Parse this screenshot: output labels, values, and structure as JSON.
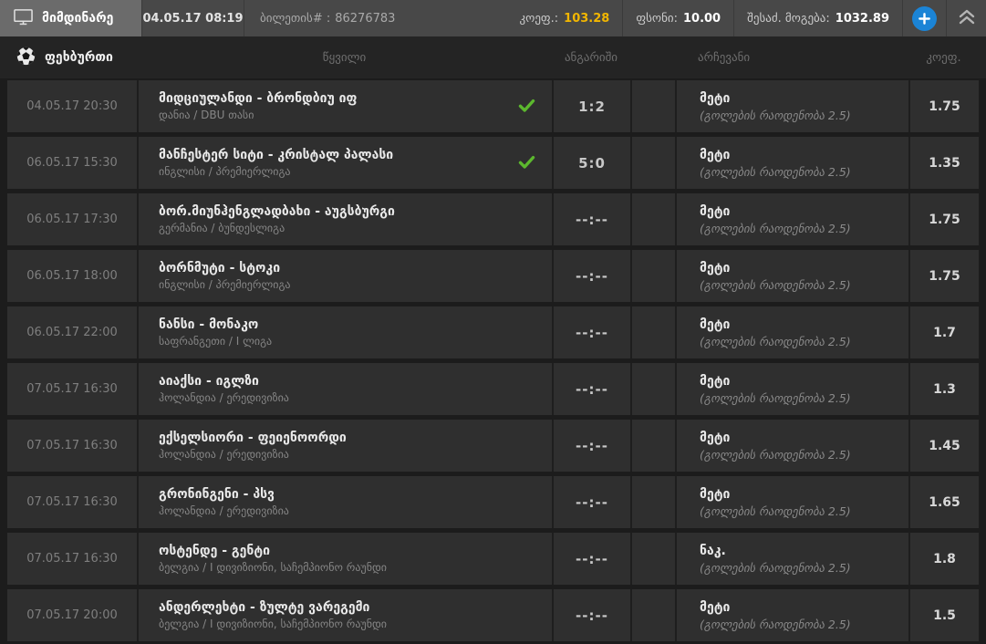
{
  "topbar": {
    "tab_label": "მიმდინარე",
    "datetime": "04.05.17 08:19",
    "ticket_label": "ბილეთის# :",
    "ticket_number": "86276783",
    "coef_label": "კოეფ.:",
    "coef_value": "103.28",
    "stake_label": "ფსონი:",
    "stake_value": "10.00",
    "win_label": "შესაძ. მოგება:",
    "win_value": "1032.89"
  },
  "section": {
    "sport_label": "ფეხბურთი",
    "columns": {
      "pair": "წყვილი",
      "score": "ანგარიში",
      "selection": "არჩევანი",
      "coef": "კოეფ."
    }
  },
  "rows": [
    {
      "datetime": "04.05.17 20:30",
      "pair": "მიდციულანდი - ბრონდბიუ იფ",
      "league": "დანია / DBU თასი",
      "won": true,
      "score": "1:2",
      "selection": "მეტი",
      "selection_detail": "(გოლების რაოდენობა 2.5)",
      "coef": "1.75"
    },
    {
      "datetime": "06.05.17 15:30",
      "pair": "მანჩესტერ სიტი - კრისტალ პალასი",
      "league": "ინგლისი / პრემიერლიგა",
      "won": true,
      "score": "5:0",
      "selection": "მეტი",
      "selection_detail": "(გოლების რაოდენობა 2.5)",
      "coef": "1.35"
    },
    {
      "datetime": "06.05.17 17:30",
      "pair": "ბორ.მიუნჰენგლადბახი - აუგსბურგი",
      "league": "გერმანია / ბუნდესლიგა",
      "won": false,
      "score": "--:--",
      "selection": "მეტი",
      "selection_detail": "(გოლების რაოდენობა 2.5)",
      "coef": "1.75"
    },
    {
      "datetime": "06.05.17 18:00",
      "pair": "ბორნმუტი - სტოკი",
      "league": "ინგლისი / პრემიერლიგა",
      "won": false,
      "score": "--:--",
      "selection": "მეტი",
      "selection_detail": "(გოლების რაოდენობა 2.5)",
      "coef": "1.75"
    },
    {
      "datetime": "06.05.17 22:00",
      "pair": "ნანსი - მონაკო",
      "league": "საფრანგეთი / I ლიგა",
      "won": false,
      "score": "--:--",
      "selection": "მეტი",
      "selection_detail": "(გოლების რაოდენობა 2.5)",
      "coef": "1.7"
    },
    {
      "datetime": "07.05.17 16:30",
      "pair": "აიაქსი - იგლზი",
      "league": "ჰოლანდია / ერედივიზია",
      "won": false,
      "score": "--:--",
      "selection": "მეტი",
      "selection_detail": "(გოლების რაოდენობა 2.5)",
      "coef": "1.3"
    },
    {
      "datetime": "07.05.17 16:30",
      "pair": "ექსელსიორი - ფეიენოორდი",
      "league": "ჰოლანდია / ერედივიზია",
      "won": false,
      "score": "--:--",
      "selection": "მეტი",
      "selection_detail": "(გოლების რაოდენობა 2.5)",
      "coef": "1.45"
    },
    {
      "datetime": "07.05.17 16:30",
      "pair": "გრონინგენი - პსვ",
      "league": "ჰოლანდია / ერედივიზია",
      "won": false,
      "score": "--:--",
      "selection": "მეტი",
      "selection_detail": "(გოლების რაოდენობა 2.5)",
      "coef": "1.65"
    },
    {
      "datetime": "07.05.17 16:30",
      "pair": "ოსტენდე - გენტი",
      "league": "ბელგია / I დივიზიონი, საჩემპიონო რაუნდი",
      "won": false,
      "score": "--:--",
      "selection": "ნაკ.",
      "selection_detail": "(გოლების რაოდენობა 2.5)",
      "coef": "1.8"
    },
    {
      "datetime": "07.05.17 20:00",
      "pair": "ანდერლეხტი - ზულტე ვარეგემი",
      "league": "ბელგია / I დივიზიონი, საჩემპიონო რაუნდი",
      "won": false,
      "score": "--:--",
      "selection": "მეტი",
      "selection_detail": "(გოლების რაოდენობა 2.5)",
      "coef": "1.5"
    }
  ],
  "colors": {
    "coef_yellow": "#f2b600",
    "check_green": "#5cb82e",
    "add_button_blue": "#1b84d6"
  }
}
